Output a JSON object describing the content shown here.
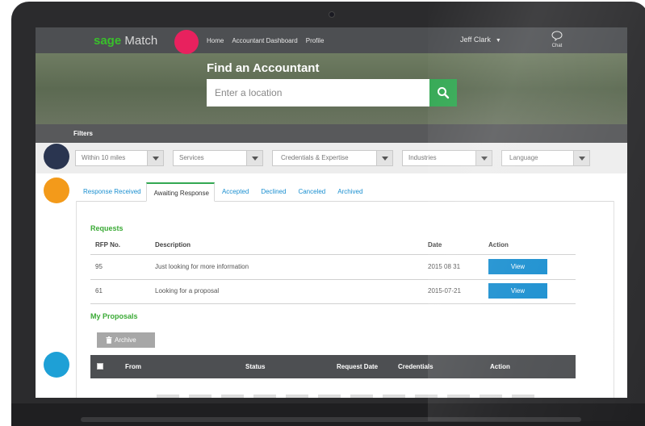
{
  "brand": {
    "sage": "sage",
    "match": "Match"
  },
  "nav": {
    "links": [
      "Home",
      "Accountant Dashboard",
      "Profile"
    ],
    "user": "Jeff Clark",
    "chat": "Chat"
  },
  "hero": {
    "title": "Find an Accountant",
    "location_placeholder": "Enter a location"
  },
  "filters": {
    "label": "Filters",
    "selects": [
      "Within 10 miles",
      "Services",
      "Credentials & Expertise",
      "Industries",
      "Language"
    ]
  },
  "tabs": [
    "Response Received",
    "Awaiting Response",
    "Accepted",
    "Declined",
    "Canceled",
    "Archived"
  ],
  "active_tab": "Awaiting Response",
  "requests": {
    "title": "Requests",
    "headers": [
      "RFP No.",
      "Description",
      "Date",
      "Action"
    ],
    "rows": [
      {
        "rfp": "95",
        "description": "Just looking for more information",
        "date": "2015 08 31",
        "action": "View"
      },
      {
        "rfp": "61",
        "description": "Looking for a proposal",
        "date": "2015-07-21",
        "action": "View"
      }
    ]
  },
  "proposals": {
    "title": "My Proposals",
    "archive_label": "Archive",
    "headers": [
      "From",
      "Status",
      "Request Date",
      "Credentials",
      "Action"
    ]
  },
  "colors": {
    "accent_green": "#33a853",
    "link_blue": "#1a8fd0",
    "dot_pink": "#e8215e",
    "dot_navy": "#2a3550",
    "dot_orange": "#f39a1a",
    "dot_blue": "#1ea0d6"
  }
}
